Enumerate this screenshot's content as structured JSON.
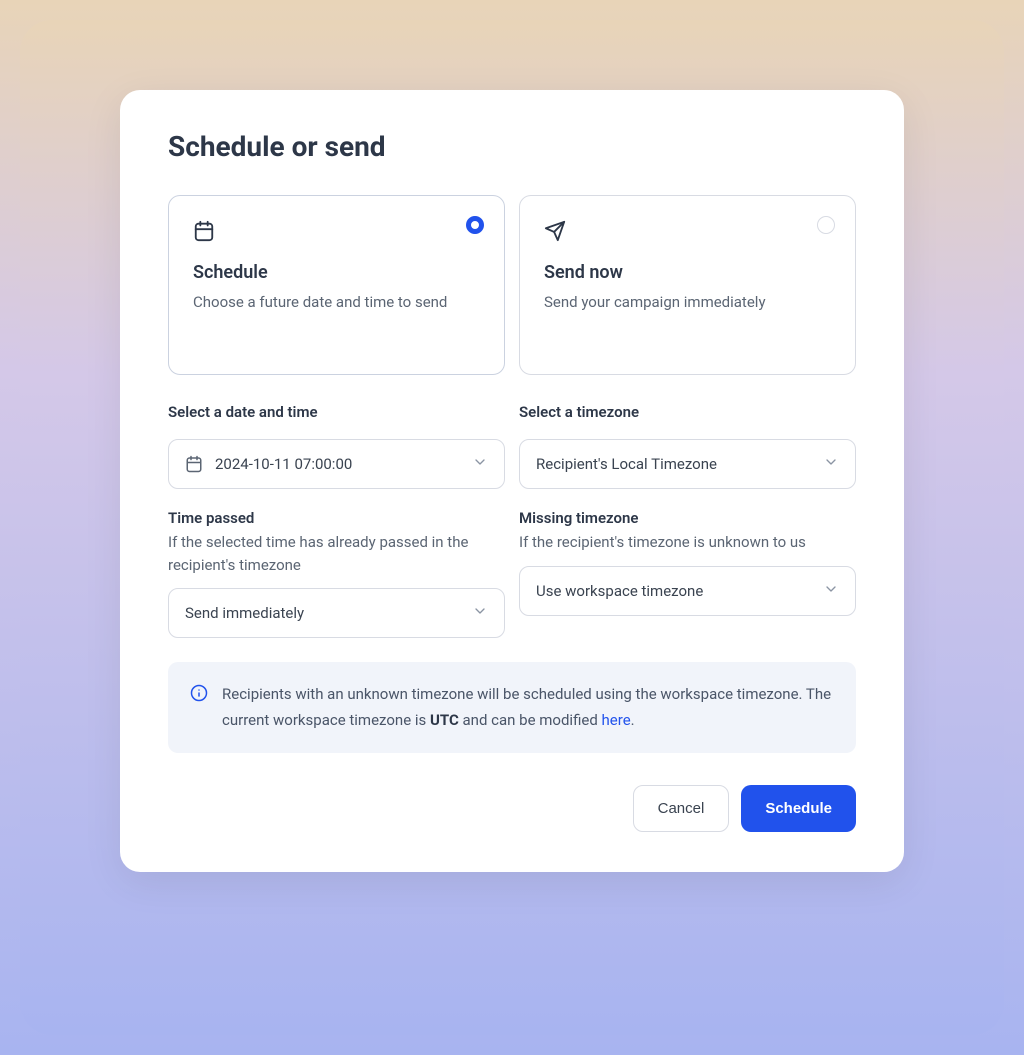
{
  "modal": {
    "title": "Schedule or send",
    "options": {
      "schedule": {
        "title": "Schedule",
        "description": "Choose a future date and time to send",
        "selected": true
      },
      "send_now": {
        "title": "Send now",
        "description": "Send your campaign immediately",
        "selected": false
      }
    },
    "fields": {
      "datetime": {
        "label": "Select a date and time",
        "value": "2024-10-11 07:00:00"
      },
      "timezone": {
        "label": "Select a timezone",
        "value": "Recipient's Local Timezone"
      },
      "time_passed": {
        "label": "Time passed",
        "helper": "If the selected time has already passed in the recipient's timezone",
        "value": "Send immediately"
      },
      "missing_timezone": {
        "label": "Missing timezone",
        "helper": "If the recipient's timezone is unknown to us",
        "value": "Use workspace timezone"
      }
    },
    "info": {
      "text_before_tz": "Recipients with an unknown timezone will be scheduled using the workspace timezone. The current workspace timezone is ",
      "timezone": "UTC",
      "text_after_tz": " and can be modified ",
      "link_text": "here",
      "text_end": "."
    },
    "buttons": {
      "cancel": "Cancel",
      "schedule": "Schedule"
    }
  }
}
